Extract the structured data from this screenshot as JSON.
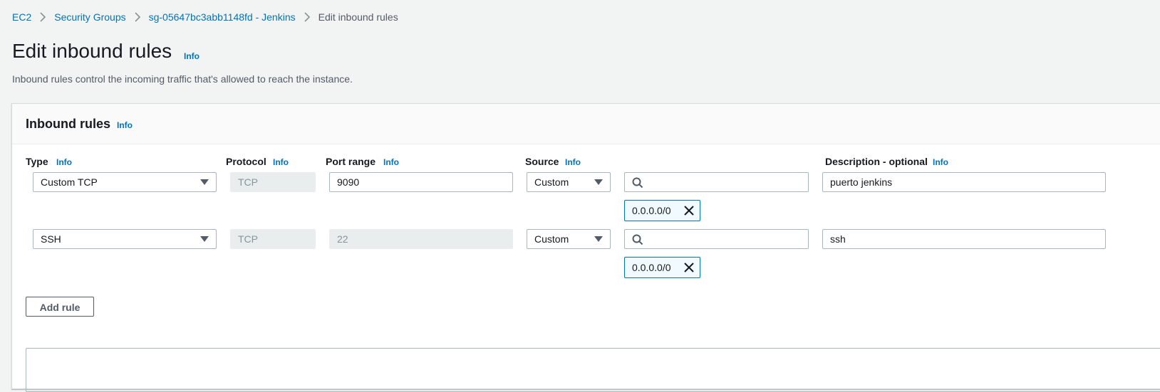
{
  "breadcrumb": {
    "items": [
      "EC2",
      "Security Groups",
      "sg-05647bc3abb1148fd - Jenkins"
    ],
    "current": "Edit inbound rules"
  },
  "header": {
    "title": "Edit inbound rules",
    "info": "Info",
    "description": "Inbound rules control the incoming traffic that's allowed to reach the instance."
  },
  "panel": {
    "title": "Inbound rules",
    "info": "Info",
    "columns": {
      "type": "Type",
      "protocol": "Protocol",
      "port_range": "Port range",
      "source": "Source",
      "description": "Description - optional",
      "info": "Info"
    },
    "rules": [
      {
        "type": "Custom TCP",
        "protocol": "TCP",
        "port": "9090",
        "source": "Custom",
        "cidr": "0.0.0.0/0",
        "description": "puerto jenkins"
      },
      {
        "type": "SSH",
        "protocol": "TCP",
        "port": "22",
        "source": "Custom",
        "cidr": "0.0.0.0/0",
        "description": "ssh"
      }
    ],
    "add_rule": "Add rule"
  },
  "icons": {
    "breadcrumb_separator": "chevron-right-icon",
    "dropdown": "caret-down-icon",
    "search": "search-icon",
    "remove": "close-icon"
  },
  "colors": {
    "link": "#0073bb",
    "background": "#f2f3f3",
    "token_border": "#0073bb",
    "token_bg": "#f1faff"
  }
}
